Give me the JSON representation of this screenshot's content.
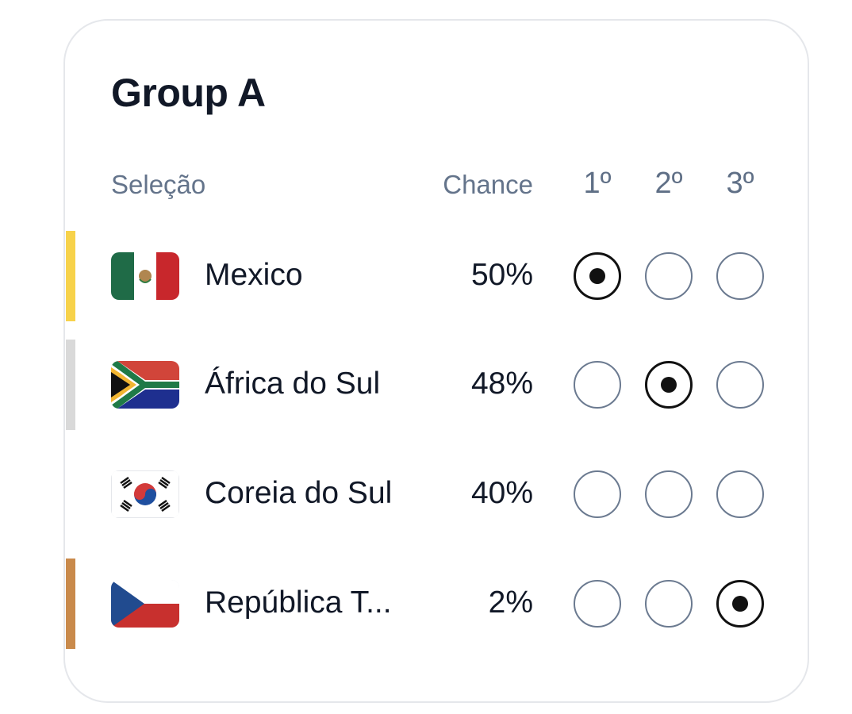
{
  "group": {
    "title": "Group A"
  },
  "headers": {
    "selection": "Seleção",
    "chance": "Chance",
    "first": "1º",
    "second": "2º",
    "third": "3º"
  },
  "teams": [
    {
      "name": "Mexico",
      "chance": "50%",
      "flag": "mexico-flag-icon",
      "accent": "#f7d24a",
      "selected_place": 1
    },
    {
      "name": "África do Sul",
      "chance": "48%",
      "flag": "south-africa-flag-icon",
      "accent": "#d9d9d9",
      "selected_place": 2
    },
    {
      "name": "Coreia do Sul",
      "chance": "40%",
      "flag": "south-korea-flag-icon",
      "accent": "",
      "selected_place": 0
    },
    {
      "name": "República T...",
      "chance": "2%",
      "flag": "czech-republic-flag-icon",
      "accent": "#c98a4b",
      "selected_place": 3
    }
  ]
}
